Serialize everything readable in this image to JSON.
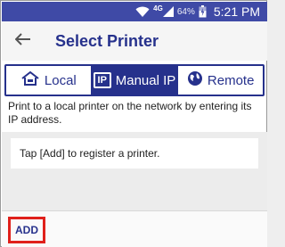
{
  "status_bar": {
    "network_label": "4G",
    "battery_percent": "64%",
    "time": "5:21 PM"
  },
  "header": {
    "title": "Select Printer",
    "back_icon": "arrow-back-icon"
  },
  "tabs": [
    {
      "label": "Local",
      "icon": "home-icon",
      "active": false
    },
    {
      "label": "Manual IP",
      "icon": "ip-icon",
      "icon_text": "IP",
      "active": true
    },
    {
      "label": "Remote",
      "icon": "globe-icon",
      "active": false
    }
  ],
  "main": {
    "description": "Print to a local printer on the network by entering its IP address.",
    "hint": "Tap [Add] to register a printer."
  },
  "footer": {
    "add_label": "ADD"
  },
  "colors": {
    "status_bar": "#3f4aa6",
    "accent": "#26318c",
    "highlight": "#e0201b"
  }
}
